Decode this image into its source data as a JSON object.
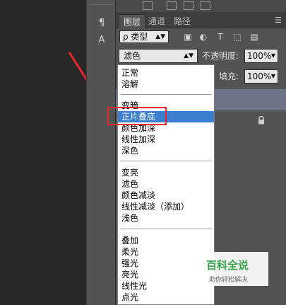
{
  "panel": {
    "tabs": [
      {
        "label": "图层"
      },
      {
        "label": "通道"
      },
      {
        "label": "路径"
      }
    ],
    "menu_icon": "panel-menu-icon",
    "filter": {
      "kind_label": "ρ 类型",
      "icons": [
        "image-filter-icon",
        "adjustment-filter-icon",
        "type-filter-icon",
        "shape-filter-icon",
        "smart-object-filter-icon"
      ]
    },
    "blend_mode_value": "滤色",
    "opacity_label": "不透明度:",
    "opacity_value": "100%",
    "fill_label": "填充:",
    "fill_value": "100%"
  },
  "tools": {
    "items": [
      "paragraph-tool-icon",
      "character-tool-icon"
    ]
  },
  "dropdown": {
    "groups": [
      [
        "正常",
        "溶解"
      ],
      [
        "变暗",
        "正片叠底",
        "颜色加深",
        "线性加深",
        "深色"
      ],
      [
        "变亮",
        "滤色",
        "颜色减淡",
        "线性减淡（添加）",
        "浅色"
      ],
      [
        "叠加",
        "柔光",
        "强光",
        "亮光",
        "线性光",
        "点光"
      ]
    ],
    "highlighted": "正片叠底"
  },
  "watermark": {
    "title": "百科全说",
    "subtitle": "助你轻松解决"
  },
  "colors": {
    "highlight": "#3b7fd0",
    "annotation_red": "#e8262c",
    "selected_layer": "#6b7587"
  }
}
